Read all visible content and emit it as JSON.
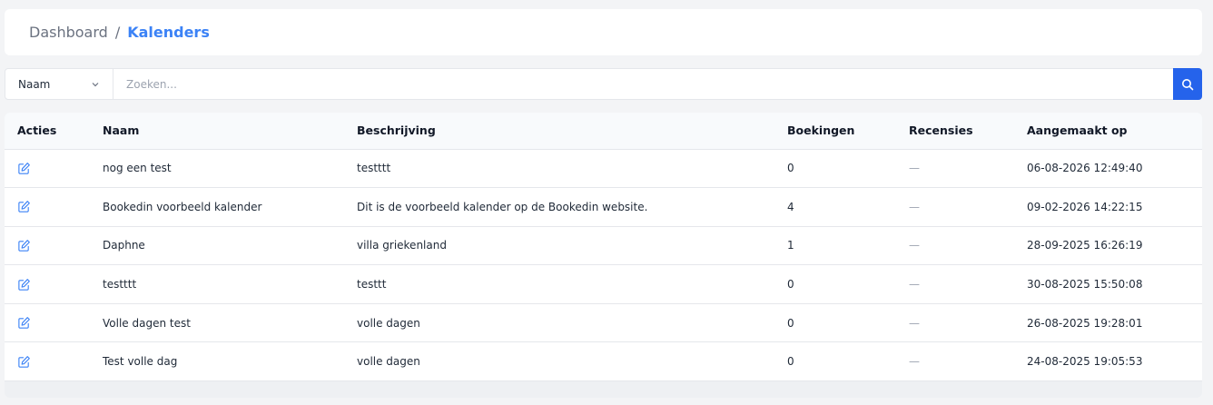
{
  "breadcrumb": {
    "home": "Dashboard",
    "separator": "/",
    "current": "Kalenders"
  },
  "search": {
    "filter_value": "Naam",
    "placeholder": "Zoeken...",
    "button_icon": "search-icon"
  },
  "table": {
    "headers": {
      "actions": "Acties",
      "name": "Naam",
      "description": "Beschrijving",
      "bookings": "Boekingen",
      "reviews": "Recensies",
      "created": "Aangemaakt op"
    },
    "rows": [
      {
        "name": "nog een test",
        "description": "testttt",
        "bookings": "0",
        "reviews": "—",
        "created": "06-08-2026 12:49:40"
      },
      {
        "name": "Bookedin voorbeeld kalender",
        "description": "Dit is de voorbeeld kalender op de Bookedin website.",
        "bookings": "4",
        "reviews": "—",
        "created": "09-02-2026 14:22:15"
      },
      {
        "name": "Daphne",
        "description": "villa griekenland",
        "bookings": "1",
        "reviews": "—",
        "created": "28-09-2025 16:26:19"
      },
      {
        "name": "testttt",
        "description": "testtt",
        "bookings": "0",
        "reviews": "—",
        "created": "30-08-2025 15:50:08"
      },
      {
        "name": "Volle dagen test",
        "description": "volle dagen",
        "bookings": "0",
        "reviews": "—",
        "created": "26-08-2025 19:28:01"
      },
      {
        "name": "Test volle dag",
        "description": "volle dagen",
        "bookings": "0",
        "reviews": "—",
        "created": "24-08-2025 19:05:53"
      }
    ]
  },
  "colors": {
    "accent": "#3b82f6",
    "button": "#2563eb",
    "edit_icon": "#3b82f6"
  }
}
